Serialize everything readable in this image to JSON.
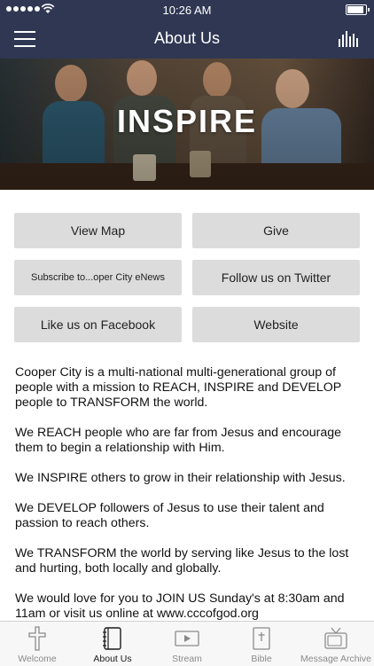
{
  "status_bar": {
    "time": "10:26 AM",
    "battery_percent": 100
  },
  "header": {
    "title": "About Us"
  },
  "hero": {
    "text": "INSPIRE"
  },
  "buttons": {
    "view_map": "View Map",
    "give": "Give",
    "subscribe": "Subscribe to...oper City eNews",
    "follow_twitter": "Follow us on Twitter",
    "like_facebook": "Like us on Facebook",
    "website": "Website"
  },
  "about": {
    "p1": "Cooper City is a multi-national multi-generational group of people with a mission to REACH, INSPIRE and DEVELOP people to TRANSFORM the world.",
    "p2": "We REACH people who are far from Jesus and encourage them to begin a relationship with Him.",
    "p3": "We INSPIRE others to grow in their relationship with Jesus.",
    "p4": "We DEVELOP followers of Jesus to use their talent and passion to reach others.",
    "p5": "We TRANSFORM the world by serving like Jesus to the lost and hurting, both locally and globally.",
    "p6": "We would love for you to JOIN US Sunday's at 8:30am and 11am or visit us online at www.cccofgod.org"
  },
  "tabs": [
    {
      "label": "Welcome",
      "icon": "cross-icon",
      "active": false
    },
    {
      "label": "About Us",
      "icon": "notebook-icon",
      "active": true
    },
    {
      "label": "Stream",
      "icon": "video-icon",
      "active": false
    },
    {
      "label": "Bible",
      "icon": "bible-icon",
      "active": false
    },
    {
      "label": "Message Archive",
      "icon": "tv-icon",
      "active": false
    }
  ],
  "colors": {
    "nav_background": "#2f3753",
    "button_background": "#dcdcdc",
    "tab_active": "#1a1a1a",
    "tab_inactive": "#8a8a8a"
  }
}
